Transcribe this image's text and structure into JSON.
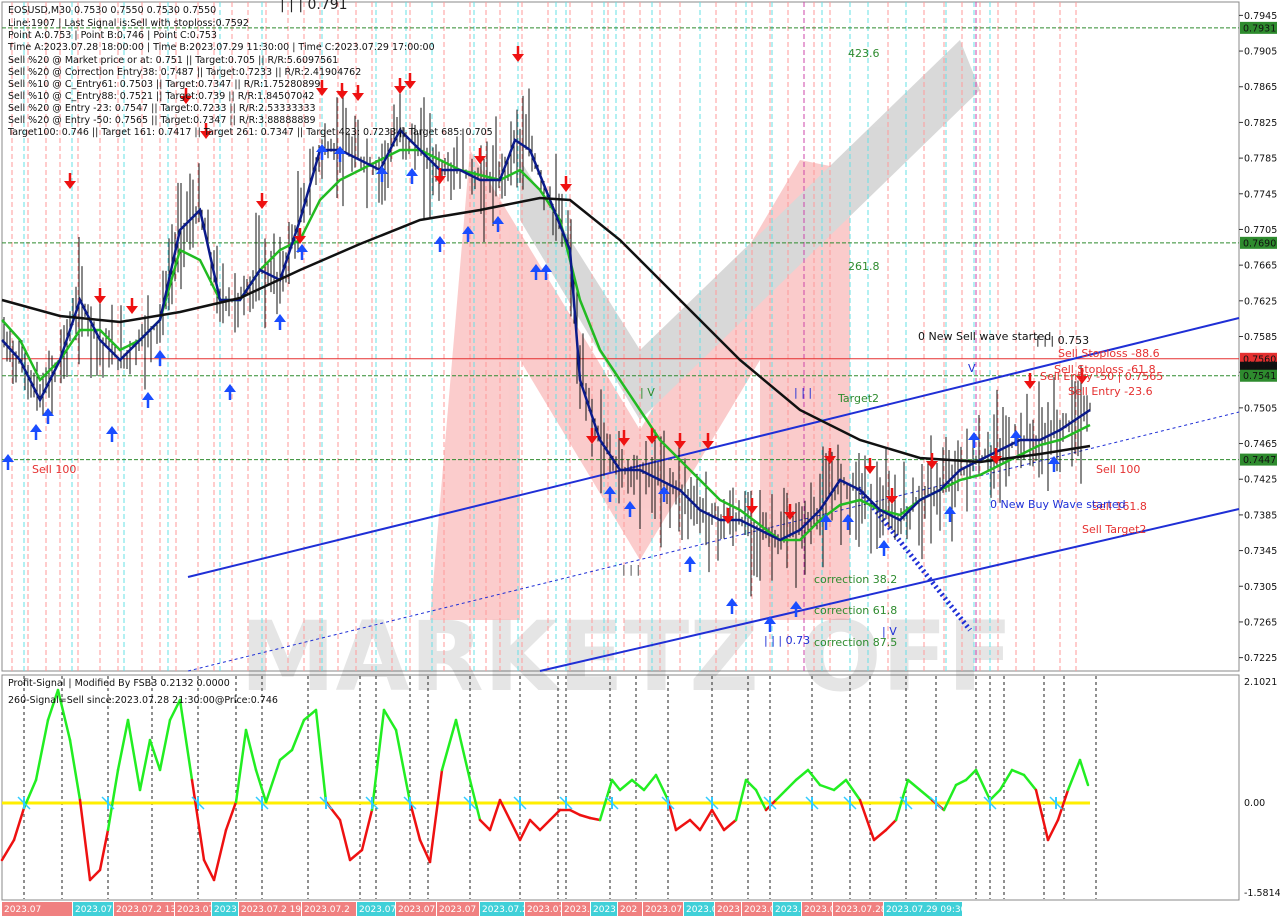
{
  "colors": {
    "background": "#ffffff",
    "grid_red": "#ff9a9a",
    "grid_cyan": "#66e0e6",
    "grid_magenta": "#cc44aa",
    "channel_blue": "#1f2fd6",
    "ma_black": "#111111",
    "ma_navy": "#0a1a8a",
    "ma_green": "#22bb22",
    "level_green": "#2e8b2e",
    "level_red": "#e53030",
    "osc_green": "#22ee22",
    "osc_red": "#ee1111",
    "osc_zero": "#ffee00",
    "date_bar_red": "#f08080",
    "date_bar_cyan": "#40d0d8"
  },
  "header": {
    "lines": [
      "EOSUSD,M30  0.7530 0.7550 0.7530 0.7550",
      "Line:1907 | Last Signal is:Sell with stoploss:0.7592",
      "Point A:0.753 | Point B:0.746 | Point C:0.753",
      "Time A:2023.07.28 18:00:00 | Time B:2023.07.29 11:30:00 | Time C:2023.07.29 17:00:00",
      "Sell %20 @ Market price or at: 0.751 || Target:0.705 || R/R:5.6097561",
      "Sell %20 @ Correction Entry38: 0.7487 || Target:0.7233 || R/R:2.41904762",
      "Sell %10 @ C_Entry61: 0.7503 || Target:0.7347 || R/R:1.75280899",
      "Sell %10 @ C_Entry88: 0.7521 || Target:0.739 || R/R:1.84507042",
      "Sell %20 @ Entry -23: 0.7547 || Target:0.7233 || R/R:2.53333333",
      "Sell %20 @ Entry -50: 0.7565 || Target:0.7347 || R/R:3.88888889",
      "Target100: 0.746 || Target 161: 0.7417 || Target 261: 0.7347 || Target 423: 0.7233 || Target 685: 0.705"
    ]
  },
  "watermark_top": "| | | 0.791",
  "price_axis": {
    "ticks": [
      "0.7945",
      "0.7905",
      "0.7865",
      "0.7825",
      "0.7785",
      "0.7745",
      "0.7705",
      "0.7665",
      "0.7625",
      "0.7585",
      "0.7545",
      "0.7505",
      "0.7465",
      "0.7425",
      "0.7385",
      "0.7345",
      "0.7305",
      "0.7265",
      "0.7225"
    ],
    "highlights": [
      {
        "label": "0.7931",
        "color": "#2e8b2e"
      },
      {
        "label": "0.7690",
        "color": "#2e8b2e"
      },
      {
        "label": "0.7560",
        "color": "#e53030"
      },
      {
        "label": "0.7550",
        "color": "#111111"
      },
      {
        "label": "0.7541",
        "color": "#2e8b2e"
      },
      {
        "label": "0.7447",
        "color": "#2e8b2e"
      }
    ]
  },
  "annotations": {
    "fib_423": "423.6",
    "fib_261": "261.8",
    "target_label": "Target2",
    "new_sell_wave": "0 New Sell wave started",
    "wave_753": "| | | 0.753",
    "sell_stoploss_88": "Sell Stoploss -88.6",
    "sell_stoploss_61": "Sell Stoploss -61.8",
    "sell_entry_50": "Sell Entry -50 | 0.7565",
    "sell_entry_23": "Sell Entry -23.6",
    "sell_100_left": "Sell 100",
    "sell_100_right": "Sell 100",
    "sell_161": "Sell 161.8",
    "sell_target2": "Sell Target2",
    "new_buy_wave": "0 New Buy Wave started",
    "correction_38": "correction 38.2",
    "correction_61": "correction 61.8",
    "correction_87": "correction 87.5",
    "wave_iii_073": "| | | 0.73",
    "wave_iv_left": "| V",
    "wave_iii_mid": "| | |",
    "wave_i": "| | |",
    "wave_v_top": "V",
    "wave_iv_bottom": "| V"
  },
  "oscillator": {
    "title": "Profit-Signal | Modified By FSB3 0.2132 0.0000",
    "signal_text": "260-Signal=Sell since:2023.07.28 21:30:00@Price:0.746",
    "axis": [
      "2.1021",
      "0.00",
      "-1.5814"
    ]
  },
  "time_axis": {
    "labels": [
      "2023.07",
      "2023.07.2",
      "2023.07.2 13:30",
      "2023.07",
      "2023",
      "2023.07.2 19:00",
      "2023.07.2",
      "2023.07",
      "2023.07",
      "2023.07",
      "2023.07.2",
      "2023.07",
      "2023.0",
      "2023",
      "202",
      "2023.07",
      "2023.0",
      "2023",
      "2023.0",
      "2023.0",
      "2023.0",
      "2023.07.28",
      "2023.07.29 09:30"
    ]
  }
}
